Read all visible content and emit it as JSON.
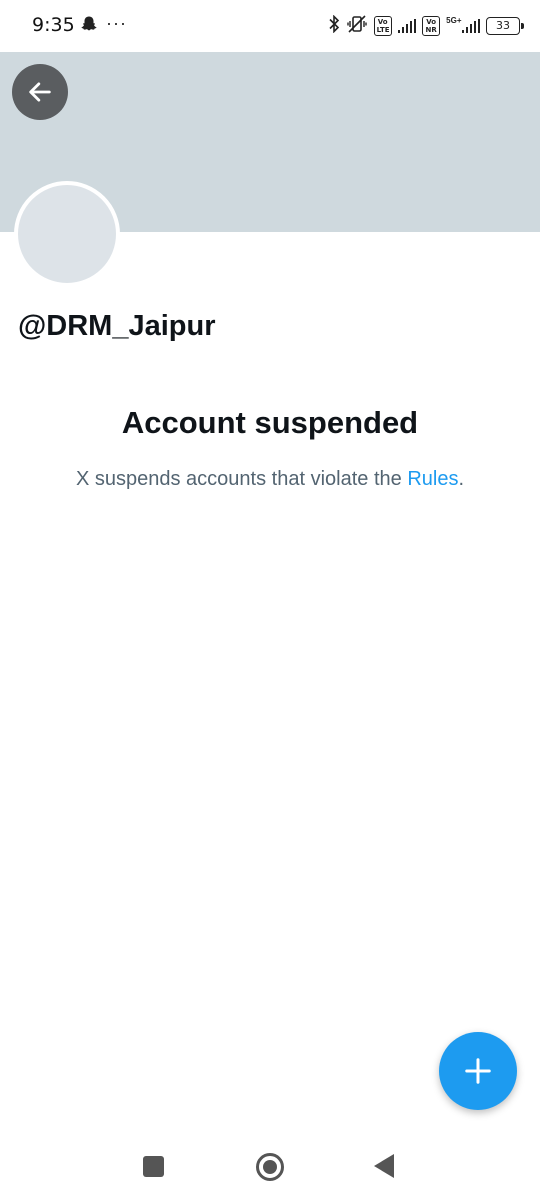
{
  "status_bar": {
    "time": "9:35",
    "more_indicator": "···",
    "battery_level": "33",
    "network_badge_1": "Vo LTE",
    "network_badge_2": "Vo NR",
    "network_type": "5G+"
  },
  "profile": {
    "handle": "@DRM_Jaipur"
  },
  "suspension": {
    "title": "Account suspended",
    "message_prefix": "X suspends accounts that violate the ",
    "rules_link": "Rules",
    "message_suffix": "."
  },
  "icons": {
    "back": "arrow-left-icon",
    "fab": "plus-icon",
    "notification": "snapchat-ghost-icon",
    "bluetooth": "bluetooth-icon",
    "silent": "vibrate-off-icon"
  },
  "colors": {
    "banner": "#cfd9de",
    "accent": "#1d9bf0",
    "secondary_text": "#536471",
    "primary_text": "#0f1419"
  }
}
